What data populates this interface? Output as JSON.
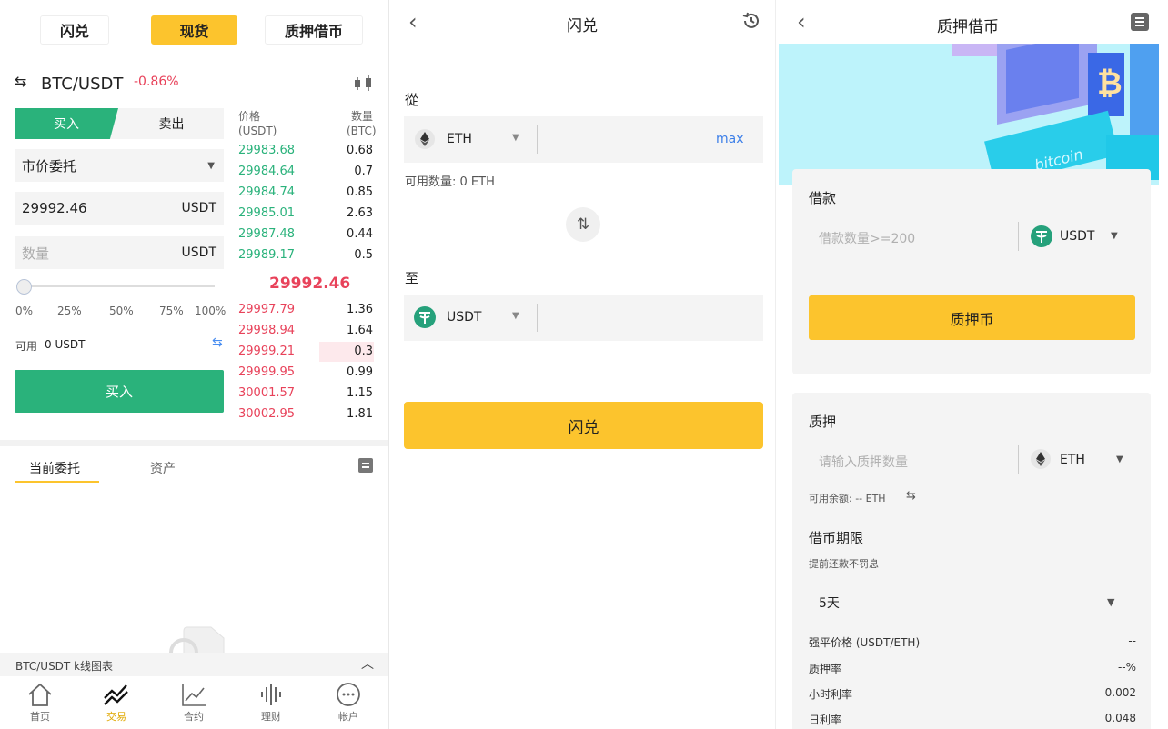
{
  "panel1": {
    "tabs": [
      {
        "label": "闪兑"
      },
      {
        "label": "现货"
      },
      {
        "label": "质押借币"
      }
    ],
    "pair": "BTC/USDT",
    "change": "-0.86%",
    "buy_tab": "买入",
    "sell_tab": "卖出",
    "order_type": "市价委托",
    "price_value": "29992.46",
    "price_unit": "USDT",
    "qty_placeholder": "数量",
    "qty_unit": "USDT",
    "slider_level": 0,
    "pct": [
      "0%",
      "25%",
      "50%",
      "75%",
      "100%"
    ],
    "avail_label": "可用",
    "avail_value": "0 USDT",
    "buy_button": "买入",
    "ob_price_head": "价格",
    "ob_price_unit": "(USDT)",
    "ob_qty_head": "数量",
    "ob_qty_unit": "(BTC)",
    "asks_green": [
      {
        "p": "29983.68",
        "q": "0.68"
      },
      {
        "p": "29984.64",
        "q": "0.7"
      },
      {
        "p": "29984.74",
        "q": "0.85"
      },
      {
        "p": "29985.01",
        "q": "2.63"
      },
      {
        "p": "29987.48",
        "q": "0.44"
      },
      {
        "p": "29989.17",
        "q": "0.5"
      }
    ],
    "last_price": "29992.46",
    "bids_red": [
      {
        "p": "29997.79",
        "q": "1.36"
      },
      {
        "p": "29998.94",
        "q": "1.64"
      },
      {
        "p": "29999.21",
        "q": "0.3"
      },
      {
        "p": "29999.95",
        "q": "0.99"
      },
      {
        "p": "30001.57",
        "q": "1.15"
      },
      {
        "p": "30002.95",
        "q": "1.81"
      }
    ],
    "bottom_tabs": [
      {
        "label": "当前委托"
      },
      {
        "label": "资产"
      }
    ],
    "kline_label": "BTC/USDT k线图表",
    "nav": [
      {
        "label": "首页"
      },
      {
        "label": "交易"
      },
      {
        "label": "合约"
      },
      {
        "label": "理财"
      },
      {
        "label": "帐户"
      }
    ],
    "colors": {
      "accent": "#fcc42d",
      "green": "#2ab27b",
      "red": "#e8425a"
    }
  },
  "panel2": {
    "title": "闪兑",
    "from_label": "從",
    "from_coin": "ETH",
    "max": "max",
    "avail": "可用数量: 0 ETH",
    "to_label": "至",
    "to_coin": "USDT",
    "button": "闪兑"
  },
  "panel3": {
    "title": "质押借币",
    "banner_text": "bitcoin",
    "borrow_label": "借款",
    "borrow_placeholder": "借款数量>=200",
    "borrow_coin": "USDT",
    "pledge_button": "质押币",
    "pledge_label": "质押",
    "pledge_placeholder": "请输入质押数量",
    "pledge_coin": "ETH",
    "balance": "可用余额: -- ETH",
    "term_label": "借币期限",
    "term_note": "提前还款不罚息",
    "term_value": "5天",
    "rows": [
      {
        "k": "强平价格 (USDT/ETH)",
        "v": "--"
      },
      {
        "k": "质押率",
        "v": "--%"
      },
      {
        "k": "小时利率",
        "v": "0.002"
      },
      {
        "k": "日利率",
        "v": "0.048"
      }
    ]
  }
}
